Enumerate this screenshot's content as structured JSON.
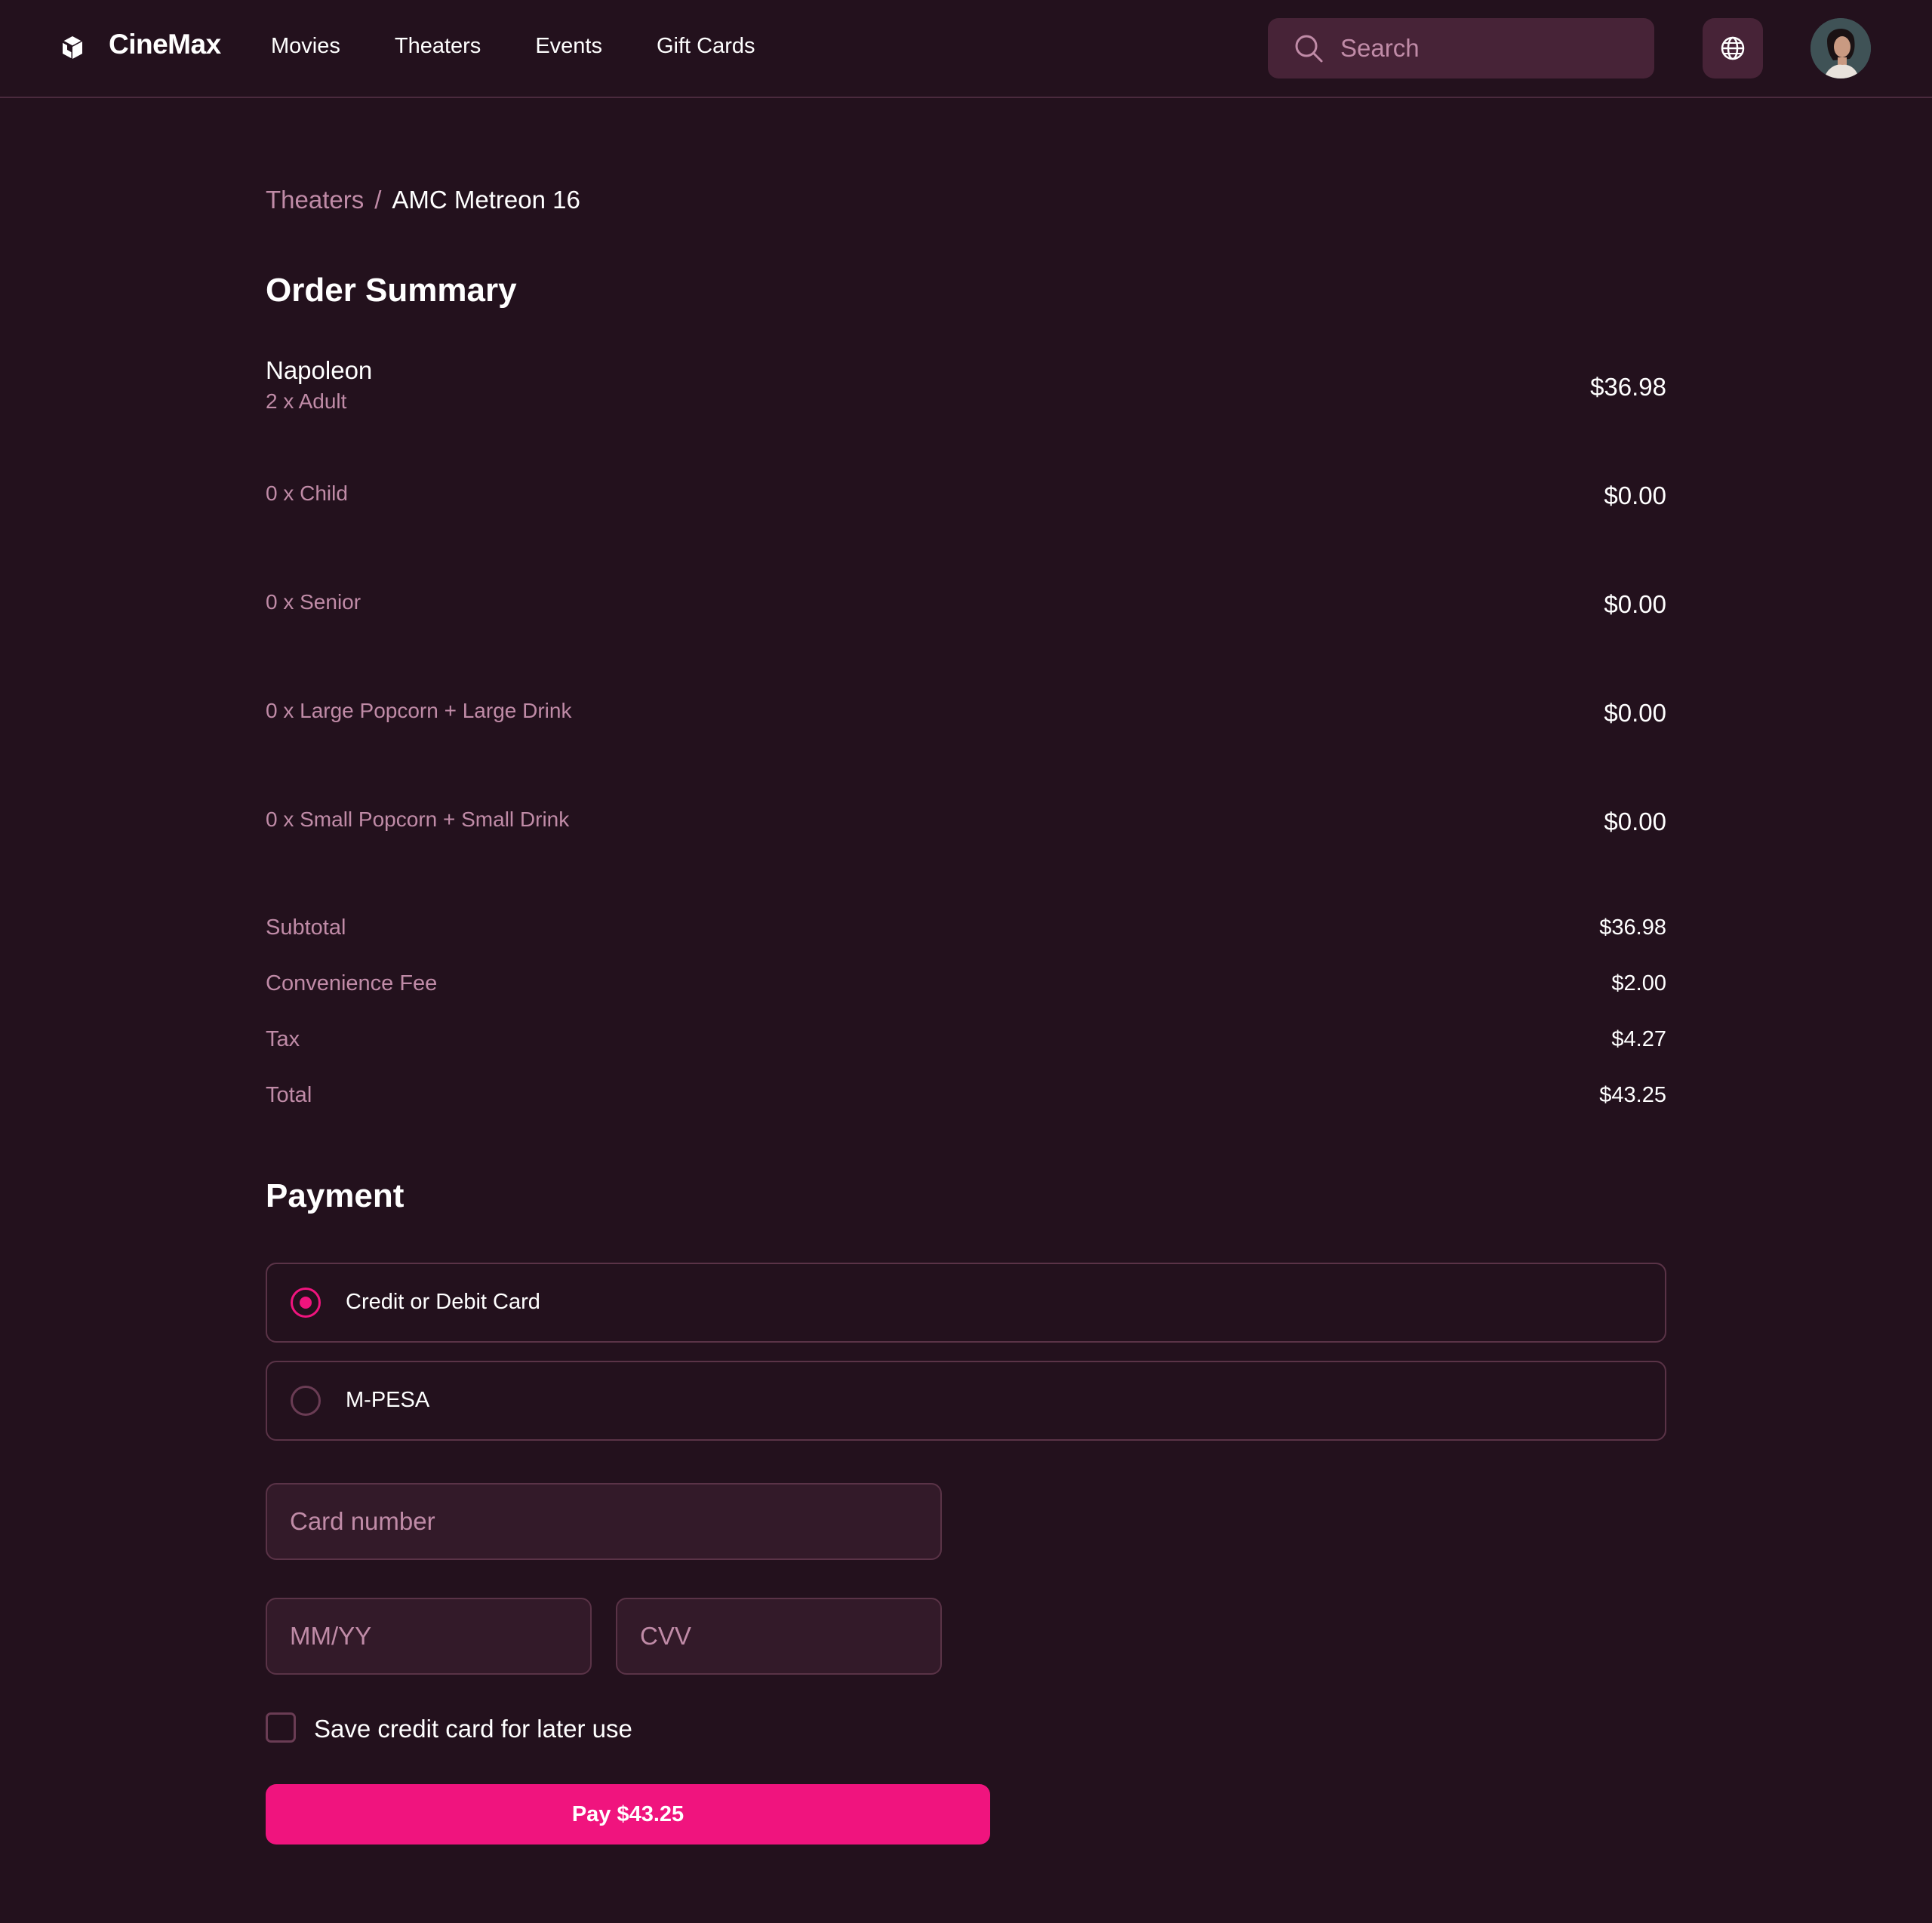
{
  "app": {
    "name": "CineMax"
  },
  "nav": {
    "items": [
      {
        "label": "Movies"
      },
      {
        "label": "Theaters"
      },
      {
        "label": "Events"
      },
      {
        "label": "Gift Cards"
      }
    ]
  },
  "search": {
    "placeholder": "Search",
    "icon": "search-icon"
  },
  "header_icons": {
    "language": "globe-icon",
    "logo": "cube-logo-icon",
    "avatar": "user-avatar"
  },
  "breadcrumb": {
    "parent": "Theaters",
    "separator": "/",
    "current": "AMC Metreon 16"
  },
  "order_summary": {
    "title": "Order Summary",
    "movie": "Napoleon",
    "items": [
      {
        "desc": "2 x Adult",
        "price": "$36.98"
      },
      {
        "desc": "0 x Child",
        "price": "$0.00"
      },
      {
        "desc": "0 x Senior",
        "price": "$0.00"
      },
      {
        "desc": "0 x Large Popcorn + Large Drink",
        "price": "$0.00"
      },
      {
        "desc": "0 x Small Popcorn + Small Drink",
        "price": "$0.00"
      }
    ],
    "totals": [
      {
        "label": "Subtotal",
        "value": "$36.98"
      },
      {
        "label": "Convenience Fee",
        "value": "$2.00"
      },
      {
        "label": "Tax",
        "value": "$4.27"
      },
      {
        "label": "Total",
        "value": "$43.25"
      }
    ]
  },
  "payment": {
    "title": "Payment",
    "methods": [
      {
        "label": "Credit or Debit Card",
        "selected": true
      },
      {
        "label": "M-PESA",
        "selected": false
      }
    ],
    "card_number_placeholder": "Card number",
    "expiry_placeholder": "MM/YY",
    "cvv_placeholder": "CVV",
    "save_card_label": "Save credit card for later use",
    "save_card_checked": false,
    "pay_button": "Pay $43.25"
  },
  "colors": {
    "background": "#23111d",
    "surface": "#472337",
    "accent": "#f0147e",
    "muted_text": "#c08ba7",
    "border": "#5a3347"
  }
}
